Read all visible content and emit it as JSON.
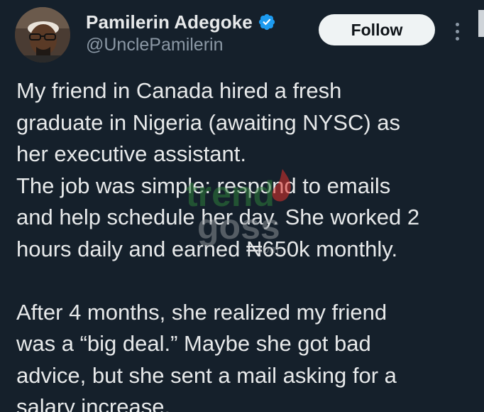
{
  "author": {
    "display_name": "Pamilerin Adegoke",
    "handle": "@UnclePamilerin",
    "verified": true
  },
  "actions": {
    "follow_label": "Follow"
  },
  "tweet": {
    "lines": [
      "My friend in Canada hired a fresh",
      "graduate in Nigeria (awaiting NYSC) as",
      "her executive assistant.",
      "The job was simple: respond to emails",
      "and help schedule her day. She worked 2",
      "hours daily and earned ₦650k monthly.",
      "",
      "After 4 months, she realized my friend",
      "was a “big deal.” Maybe she got bad",
      "advice, but she sent a mail asking for a",
      "salary increase."
    ]
  },
  "watermark": {
    "text_top": "trend",
    "text_bottom": "goss",
    "suffix": ".com"
  },
  "colors": {
    "background": "#15202b",
    "text": "#e7e9ea",
    "secondary_text": "#8b98a5",
    "verified_blue": "#1d9bf0",
    "follow_bg": "#eff3f4",
    "watermark_green": "#2e7d3a",
    "watermark_red": "#e0312b"
  }
}
